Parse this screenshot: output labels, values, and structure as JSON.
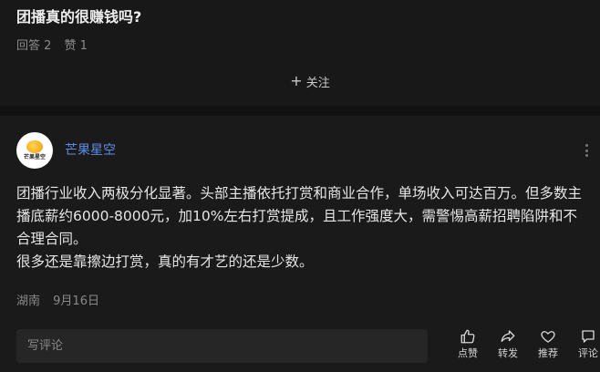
{
  "question": {
    "title": "团播真的很赚钱吗?",
    "answers": "回答 2",
    "likes": "赞 1",
    "follow_label": "关注"
  },
  "answer": {
    "author": "芒果星空",
    "avatar_logo_text": "芒果星空",
    "paragraphs": [
      "团播行业收入两极分化显著。头部主播依托打赏和商业合作，单场收入可达百万。但多数主播底薪约6000-8000元，加10%左右打赏提成，且工作强度大，需警惕高薪招聘陷阱和不合理合同。",
      "很多还是靠擦边打赏，真的有才艺的还是少数。"
    ],
    "location": "湖南",
    "date": "9月16日"
  },
  "comment": {
    "placeholder": "写评论"
  },
  "actions": {
    "like": "点赞",
    "share": "转发",
    "recommend": "推荐",
    "comment": "评论"
  },
  "icons": {
    "follow": "plus-icon",
    "more": "more-vertical-icon",
    "like": "thumbs-up-icon",
    "share": "share-arrow-icon",
    "recommend": "heart-icon",
    "comment": "comment-icon"
  },
  "colors": {
    "background": "#121212",
    "card": "#1a1a1a",
    "author": "#5c8de6",
    "text": "#e6e6e6",
    "muted": "#8a8a8a"
  }
}
